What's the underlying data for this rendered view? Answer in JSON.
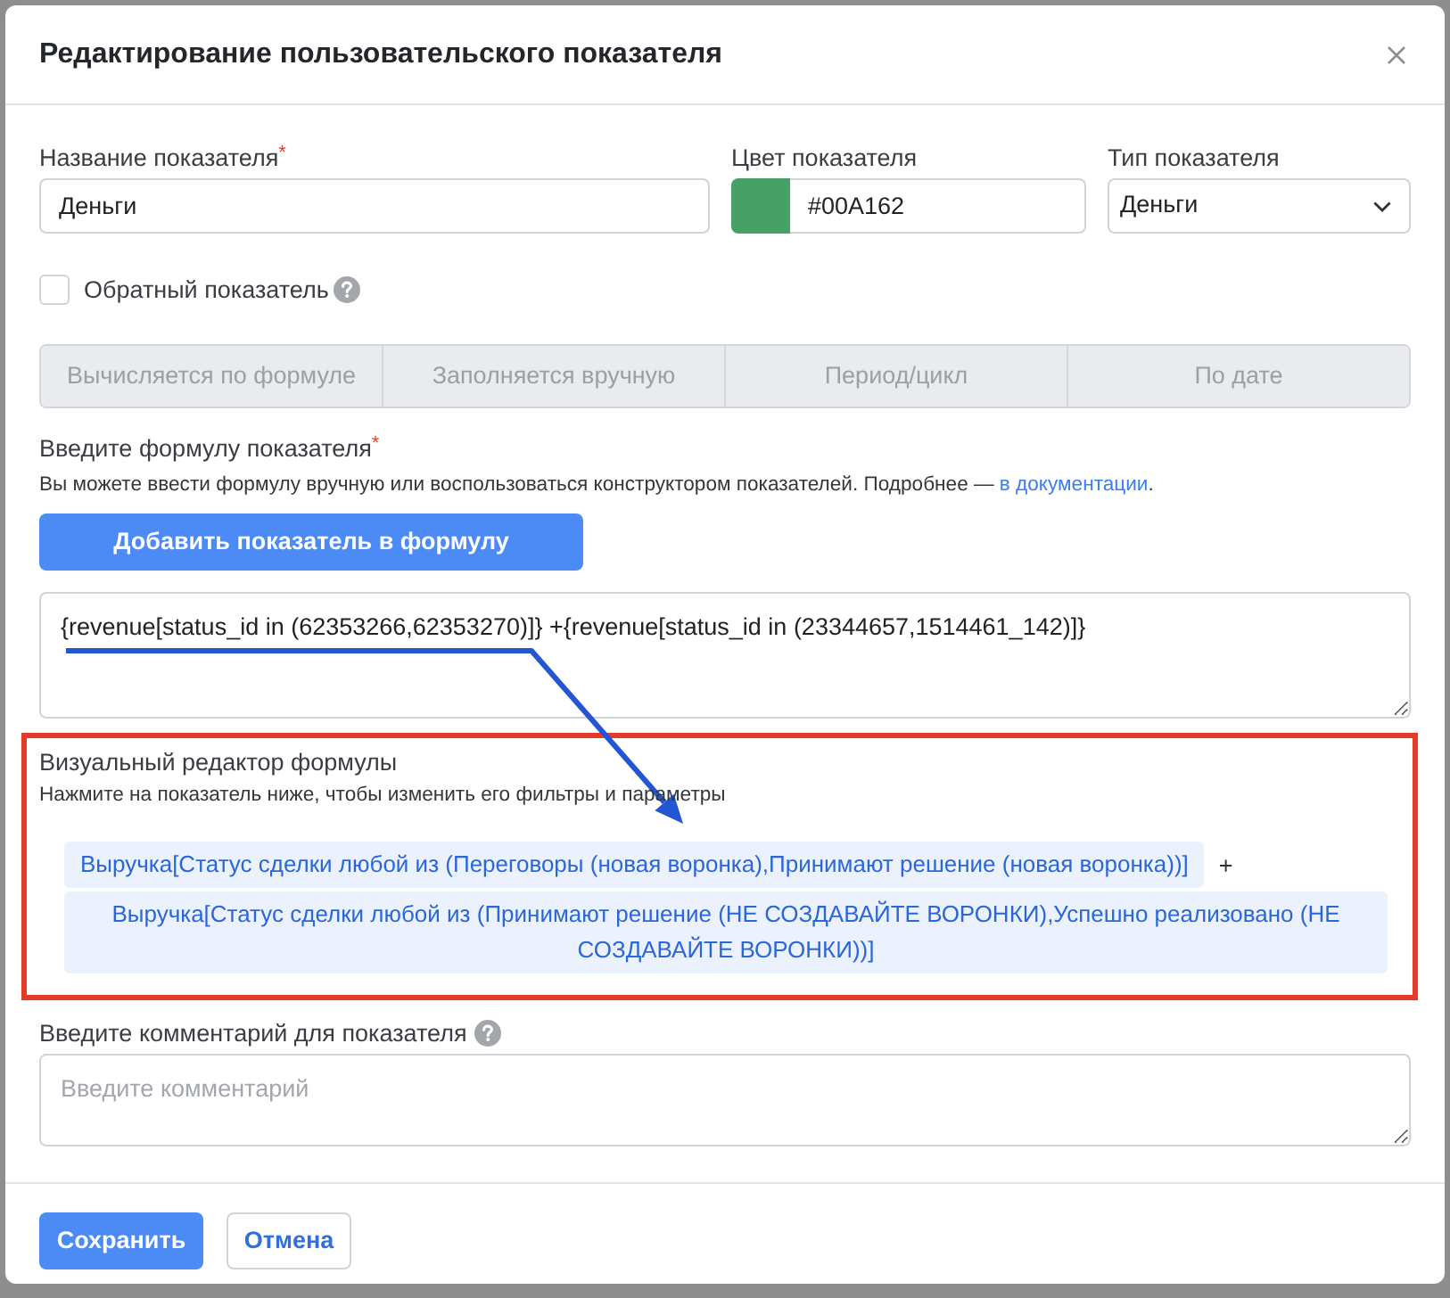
{
  "dialog": {
    "title": "Редактирование пользовательского показателя"
  },
  "name_field": {
    "label": "Название показателя$^{*}$",
    "value": "Деньги"
  },
  "color_field": {
    "label": "Цвет показателя",
    "color": "#47a065",
    "value": "#00A162"
  },
  "type_field": {
    "label": "Тип показателя",
    "value": "Деньги"
  },
  "inverse": {
    "label": "Обратный показатель",
    "checked": false
  },
  "calc_modes": {
    "disabled": true,
    "options": [
      {
        "label": "Вычисляется по формуле",
        "selected": false
      },
      {
        "label": "Заполняется вручную",
        "selected": false
      },
      {
        "label": "Период/цикл",
        "selected": false
      },
      {
        "label": "По дате",
        "selected": false
      }
    ]
  },
  "formula": {
    "label": "Введите формулу показателя$^{*}$",
    "hint": "Вы можете ввести формулу вручную или воспользоваться конструктором показателей. Подробнее — ",
    "hint_link": "в документации",
    "hint_end": ".",
    "add_button": "Добавить показатель в формулу",
    "value": "{revenue[status_id in (62353266,62353270)]} +{revenue[status_id in (23344657,1514461_142)]}"
  },
  "visual_editor": {
    "title": "Визуальный редактор формулы",
    "subtitle": "Нажмите на показатель ниже, чтобы изменить его фильтры и параметры",
    "parts": [
      {
        "kind": "metric",
        "text": "Выручка[Статус сделки любой из (Переговоры (новая воронка),Принимают решение (новая воронка))]"
      },
      {
        "kind": "operator",
        "text": "+"
      },
      {
        "kind": "metric",
        "text": "Выручка[Статус сделки любой из (Принимают решение (НЕ СОЗДАВАЙТЕ ВОРОНКИ),Успешно реализовано (НЕ СОЗДАВАЙТЕ ВОРОНКИ))]"
      }
    ]
  },
  "comment": {
    "label": "Введите комментарий для показателя",
    "placeholder": "Введите комментарий"
  },
  "footer_buttons": [
    {
      "kind": "primary",
      "label": "Сохранить"
    },
    {
      "kind": "secondary",
      "label": "Отмена"
    }
  ]
}
